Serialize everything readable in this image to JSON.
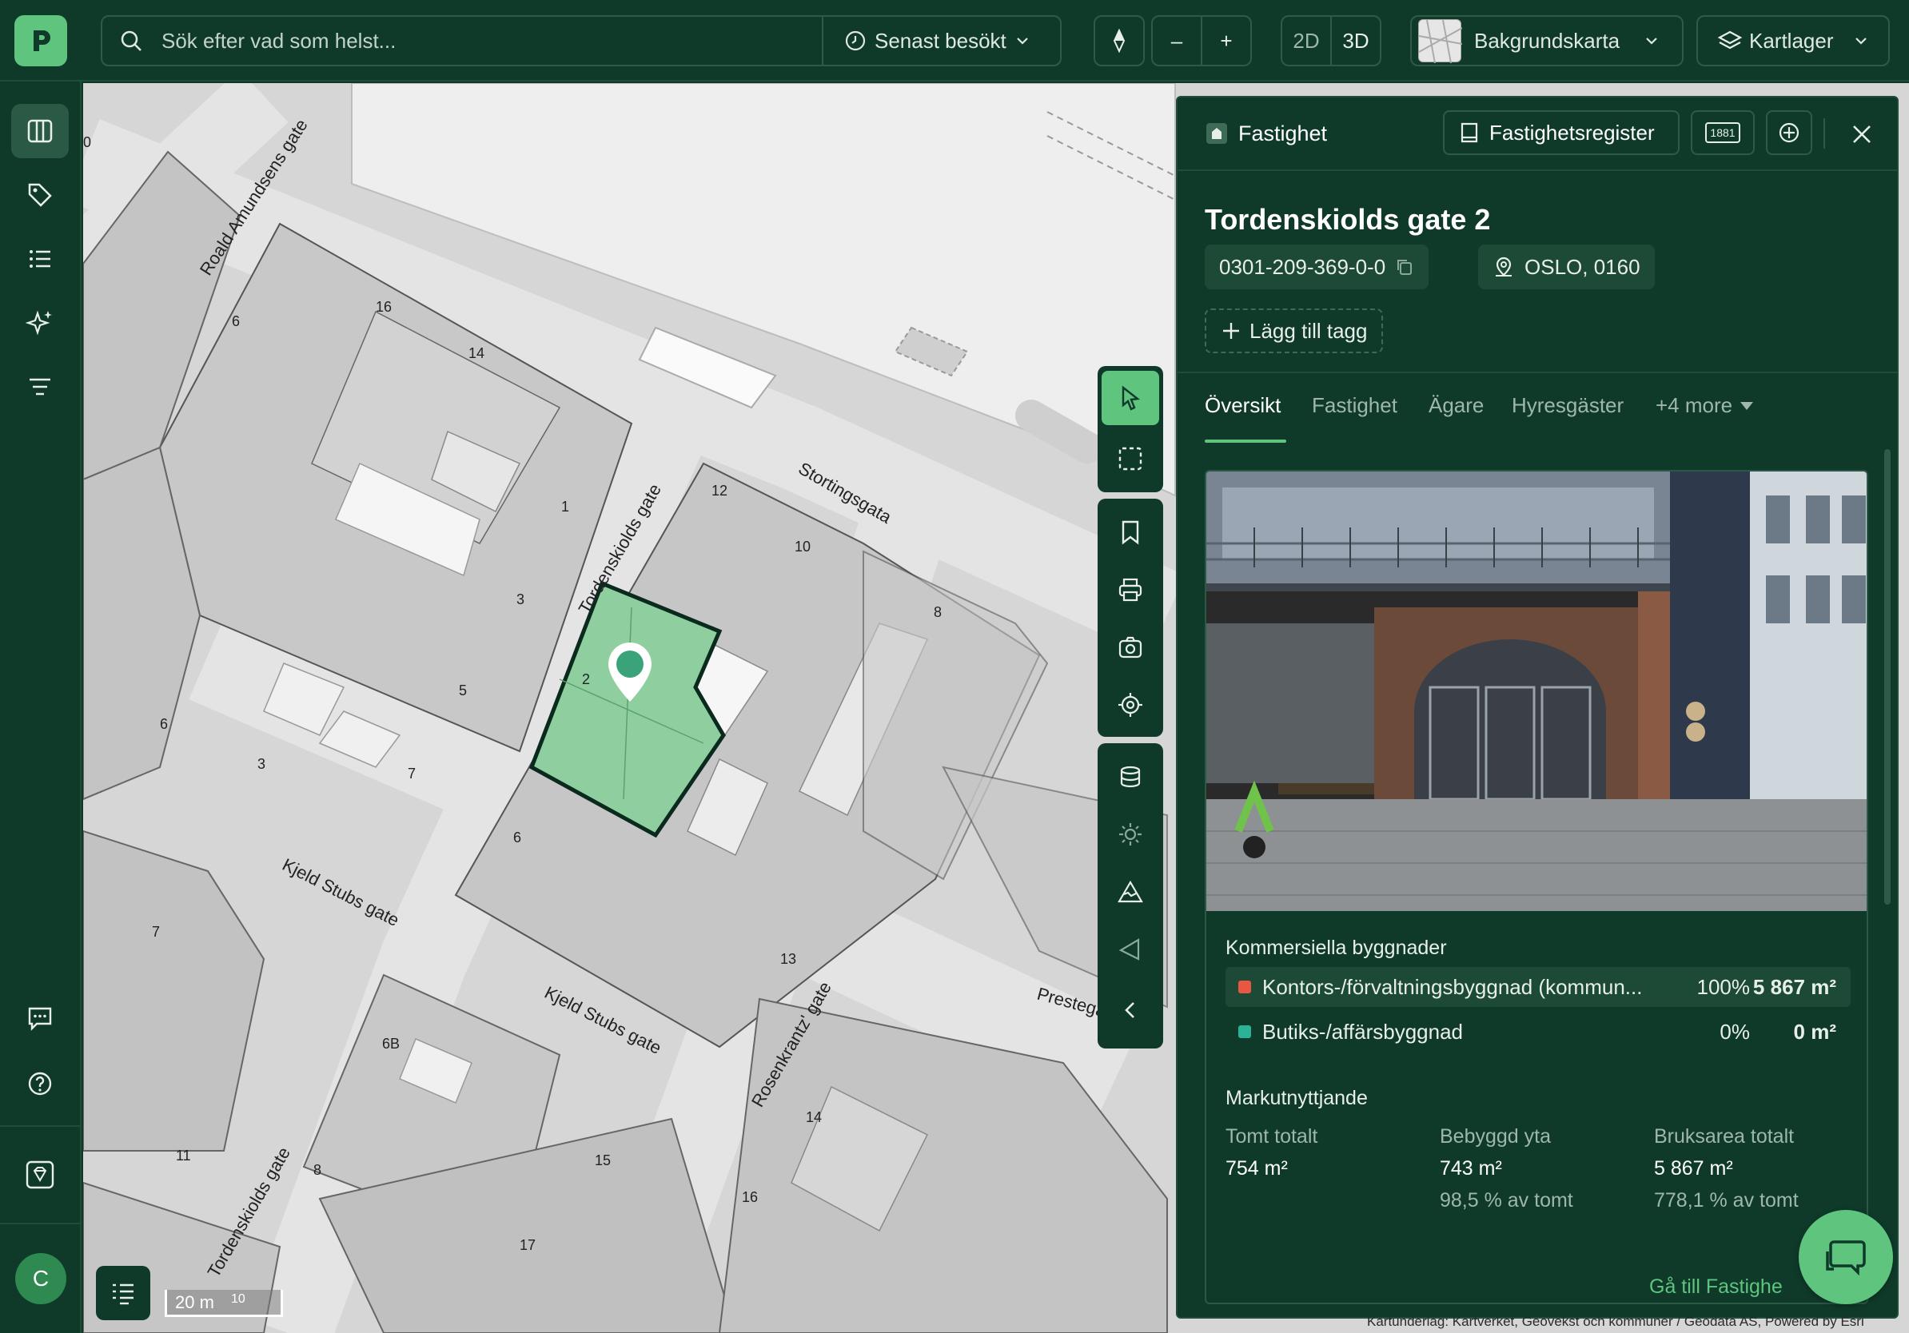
{
  "search": {
    "placeholder": "Sök efter vad som helst...",
    "recent_label": "Senast besökt"
  },
  "toolbar": {
    "zoom_out": "–",
    "zoom_in": "+",
    "mode_2d": "2D",
    "mode_3d": "3D",
    "basemap_label": "Bakgrundskarta",
    "layers_label": "Kartlager"
  },
  "rail": {
    "items": [
      "map-icon",
      "tag-icon",
      "list-icon",
      "sparkle-icon",
      "filter-icon"
    ],
    "bottom": [
      "chat-icon",
      "help-icon",
      "gem-icon"
    ],
    "avatar_initial": "C"
  },
  "map": {
    "streets": [
      "Roald Amundsens gate",
      "Stortingsgata",
      "Tordenskiolds gate",
      "Kjeld Stubs gate",
      "Kjeld Stubs gate",
      "Rosenkrantz' gate",
      "Tordenskiolds gate",
      "Prestegata"
    ],
    "house_numbers": [
      "16",
      "14",
      "6",
      "1",
      "3",
      "5",
      "7",
      "3",
      "6",
      "12",
      "10",
      "8",
      "2",
      "6",
      "13",
      "6B",
      "11",
      "8",
      "15",
      "17",
      "16",
      "14",
      "7",
      "0"
    ],
    "scale_label": "20 m",
    "scale_sub": "10",
    "attribution": "Kartunderlag: Kartverket, Geovekst och kommuner / Geodata AS, Powered by Esri"
  },
  "panel": {
    "header_label": "Fastighet",
    "register_button": "Fastighetsregister",
    "badge_1881": "1881",
    "title": "Tordenskiolds gate 2",
    "property_id": "0301-209-369-0-0",
    "location": "OSLO, 0160",
    "add_tag": "Lägg till tagg",
    "tabs": [
      "Översikt",
      "Fastighet",
      "Ägare",
      "Hyresgäster",
      "+4 more"
    ],
    "commercial_title": "Kommersiella byggnader",
    "buildings": [
      {
        "name": "Kontors-/förvaltningsbyggnad (kommun...",
        "pct": "100%",
        "area": "5 867 m²",
        "color": "#e8573f"
      },
      {
        "name": "Butiks-/affärsbyggnad",
        "pct": "0%",
        "area": "0 m²",
        "color": "#2bb39a"
      }
    ],
    "land_title": "Markutnyttjande",
    "stats": [
      {
        "label": "Tomt totalt",
        "value": "754 m²",
        "sub": ""
      },
      {
        "label": "Bebyggd yta",
        "value": "743 m²",
        "sub": "98,5 % av tomt"
      },
      {
        "label": "Bruksarea totalt",
        "value": "5 867 m²",
        "sub": "778,1 % av tomt"
      }
    ],
    "go_link": "Gå till Fastighe"
  },
  "colors": {
    "accent": "#5fc47e",
    "chrome": "#0f3a2a",
    "selected_parcel": "#8fcf9f"
  }
}
